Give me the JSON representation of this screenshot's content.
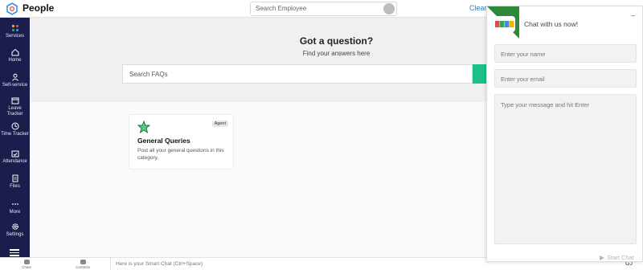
{
  "app": {
    "title": "People"
  },
  "header": {
    "search_placeholder": "Search Employee",
    "clear_link": "Clear s"
  },
  "sidebar": {
    "items": [
      {
        "label": "Services"
      },
      {
        "label": "Home"
      },
      {
        "label": "Self-service"
      },
      {
        "label": "Leave Tracker"
      },
      {
        "label": "Time Tracker"
      },
      {
        "label": "Attendance"
      },
      {
        "label": "Files"
      },
      {
        "label": "More"
      },
      {
        "label": "Settings"
      }
    ]
  },
  "hero": {
    "title": "Got a question?",
    "subtitle": "Find your answers here",
    "search_placeholder": "Search FAQs"
  },
  "card": {
    "badge": "Agent",
    "title": "General Queries",
    "description": "Post all your general questions in this category."
  },
  "bottom_bar": {
    "chats_label": "Chats",
    "contacts_label": "Contacts",
    "smart_chat_placeholder": "Here is your Smart Chat (Ctrl+Space)",
    "right_text": "GJ"
  },
  "chat_widget": {
    "title": "Chat with us now!",
    "minimize": "–",
    "name_placeholder": "Enter your name",
    "email_placeholder": "Enter your email",
    "message_placeholder": "Type your message and hit Enter",
    "start_label": "Start Chat",
    "logo_text": "ZOHO"
  },
  "colors": {
    "sidebar_bg": "#1b1d4d",
    "accent_green": "#1dbf8b",
    "chat_corner": "#2e8a3a",
    "link": "#2c7bd6"
  }
}
